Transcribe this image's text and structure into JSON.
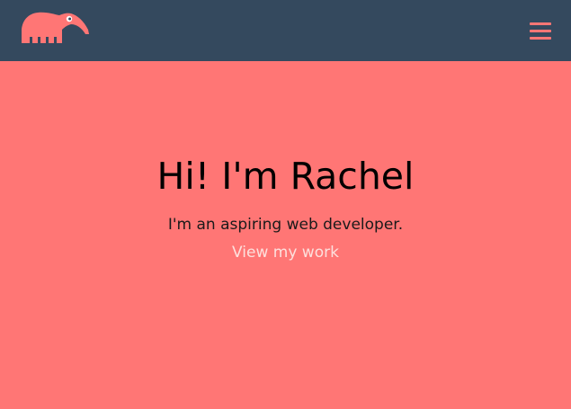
{
  "header": {
    "logo_icon": "anteater-logo-icon",
    "menu_icon": "hamburger-menu-icon"
  },
  "hero": {
    "title": "Hi! I'm Rachel",
    "subtitle": "I'm an aspiring web developer.",
    "link_label": "View my work"
  },
  "colors": {
    "background": "#ff7675",
    "header": "#34495e",
    "accent": "#ff7675",
    "title": "#000000",
    "link": "#fde0dd"
  }
}
